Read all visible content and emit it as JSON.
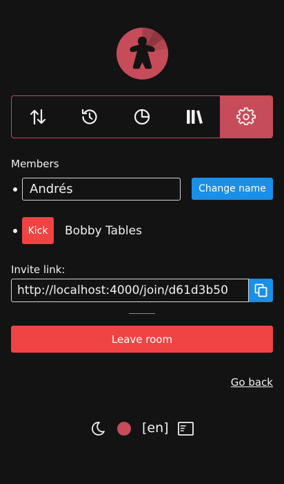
{
  "colors": {
    "accent": "#c64c5a",
    "primary_blue": "#1a8fe8",
    "danger": "#f04444",
    "background": "#131313"
  },
  "logo": {
    "icon": "meeple-logo-icon"
  },
  "tabs": [
    {
      "icon": "sort-arrows-icon",
      "active": false
    },
    {
      "icon": "history-icon",
      "active": false
    },
    {
      "icon": "pie-chart-icon",
      "active": false
    },
    {
      "icon": "library-icon",
      "active": false
    },
    {
      "icon": "gear-icon",
      "active": true
    }
  ],
  "members": {
    "label": "Members",
    "current_user_name": "Andrés",
    "change_name_label": "Change name",
    "others": [
      {
        "kick_label": "Kick",
        "name": "Bobby Tables"
      }
    ]
  },
  "invite": {
    "label": "Invite link:",
    "url": "http://localhost:4000/join/d61d3b50",
    "copy_icon": "copy-icon"
  },
  "leave_label": "Leave room",
  "go_back_label": "Go back",
  "footer": {
    "theme_icon": "moon-icon",
    "color_icon": "color-dot-icon",
    "language": "[en]",
    "layout_icon": "layout-icon"
  }
}
